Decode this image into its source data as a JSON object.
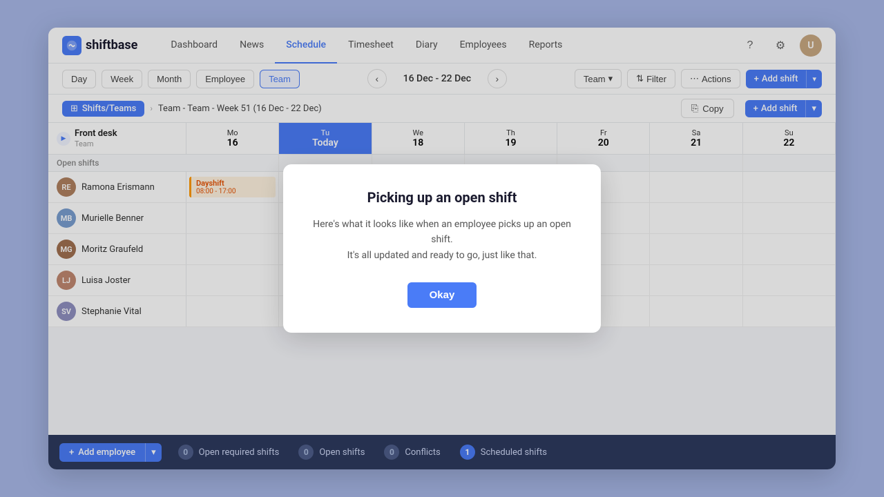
{
  "app": {
    "logo_text": "shiftbase",
    "logo_icon": "s"
  },
  "nav": {
    "links": [
      {
        "label": "Dashboard",
        "active": false
      },
      {
        "label": "News",
        "active": false
      },
      {
        "label": "Schedule",
        "active": true
      },
      {
        "label": "Timesheet",
        "active": false
      },
      {
        "label": "Diary",
        "active": false
      },
      {
        "label": "Employees",
        "active": false
      },
      {
        "label": "Reports",
        "active": false
      }
    ]
  },
  "toolbar": {
    "view_buttons": [
      {
        "label": "Day",
        "active": false
      },
      {
        "label": "Week",
        "active": false
      },
      {
        "label": "Month",
        "active": false
      },
      {
        "label": "Employee",
        "active": false
      },
      {
        "label": "Team",
        "active": true
      }
    ],
    "date_range": "16 Dec - 22 Dec",
    "team_label": "Team",
    "filter_label": "Filter",
    "actions_label": "Actions",
    "add_shift_label": "Add shift"
  },
  "breadcrumb": {
    "item": "Shifts/Teams",
    "title": "Team - Team - Week 51 (16 Dec - 22 Dec)",
    "copy_label": "Copy",
    "add_shift_label": "Add shift"
  },
  "schedule": {
    "team_label": "Front desk",
    "team_sublabel": "Team",
    "days": [
      {
        "name": "Mo",
        "num": "16",
        "today": false
      },
      {
        "name": "Today",
        "num": "",
        "today": true,
        "full": "Today"
      },
      {
        "name": "We",
        "num": "18",
        "today": false
      },
      {
        "name": "Th",
        "num": "19",
        "today": false
      },
      {
        "name": "Fr",
        "num": "20",
        "today": false
      },
      {
        "name": "Sa",
        "num": "21",
        "today": false
      },
      {
        "name": "Su",
        "num": "22",
        "today": false
      }
    ],
    "open_shifts_label": "Open shifts",
    "employees": [
      {
        "name": "Ramona Erismann",
        "color": "#b08060",
        "initials": "RE",
        "shift": {
          "day": 1,
          "name": "Dayshift",
          "time": "08:00 - 17:00"
        }
      },
      {
        "name": "Murielle Benner",
        "color": "#7a9ecf",
        "initials": "MB",
        "shift": null
      },
      {
        "name": "Moritz Graufeld",
        "color": "#a07050",
        "initials": "MG",
        "shift": null
      },
      {
        "name": "Luisa Joster",
        "color": "#c08870",
        "initials": "LJ",
        "shift": null
      },
      {
        "name": "Stephanie Vital",
        "color": "#9090c0",
        "initials": "SV",
        "shift": null
      }
    ]
  },
  "bottom_bar": {
    "add_employee_label": "Add employee",
    "stats": [
      {
        "count": 0,
        "label": "Open required shifts"
      },
      {
        "count": 0,
        "label": "Open shifts"
      },
      {
        "count": 0,
        "label": "Conflicts"
      },
      {
        "count": 1,
        "label": "Scheduled shifts"
      }
    ]
  },
  "modal": {
    "title": "Picking up an open shift",
    "body_line1": "Here's what it looks like when an employee picks up an open shift.",
    "body_line2": "It's all updated and ready to go, just like that.",
    "ok_label": "Okay"
  }
}
